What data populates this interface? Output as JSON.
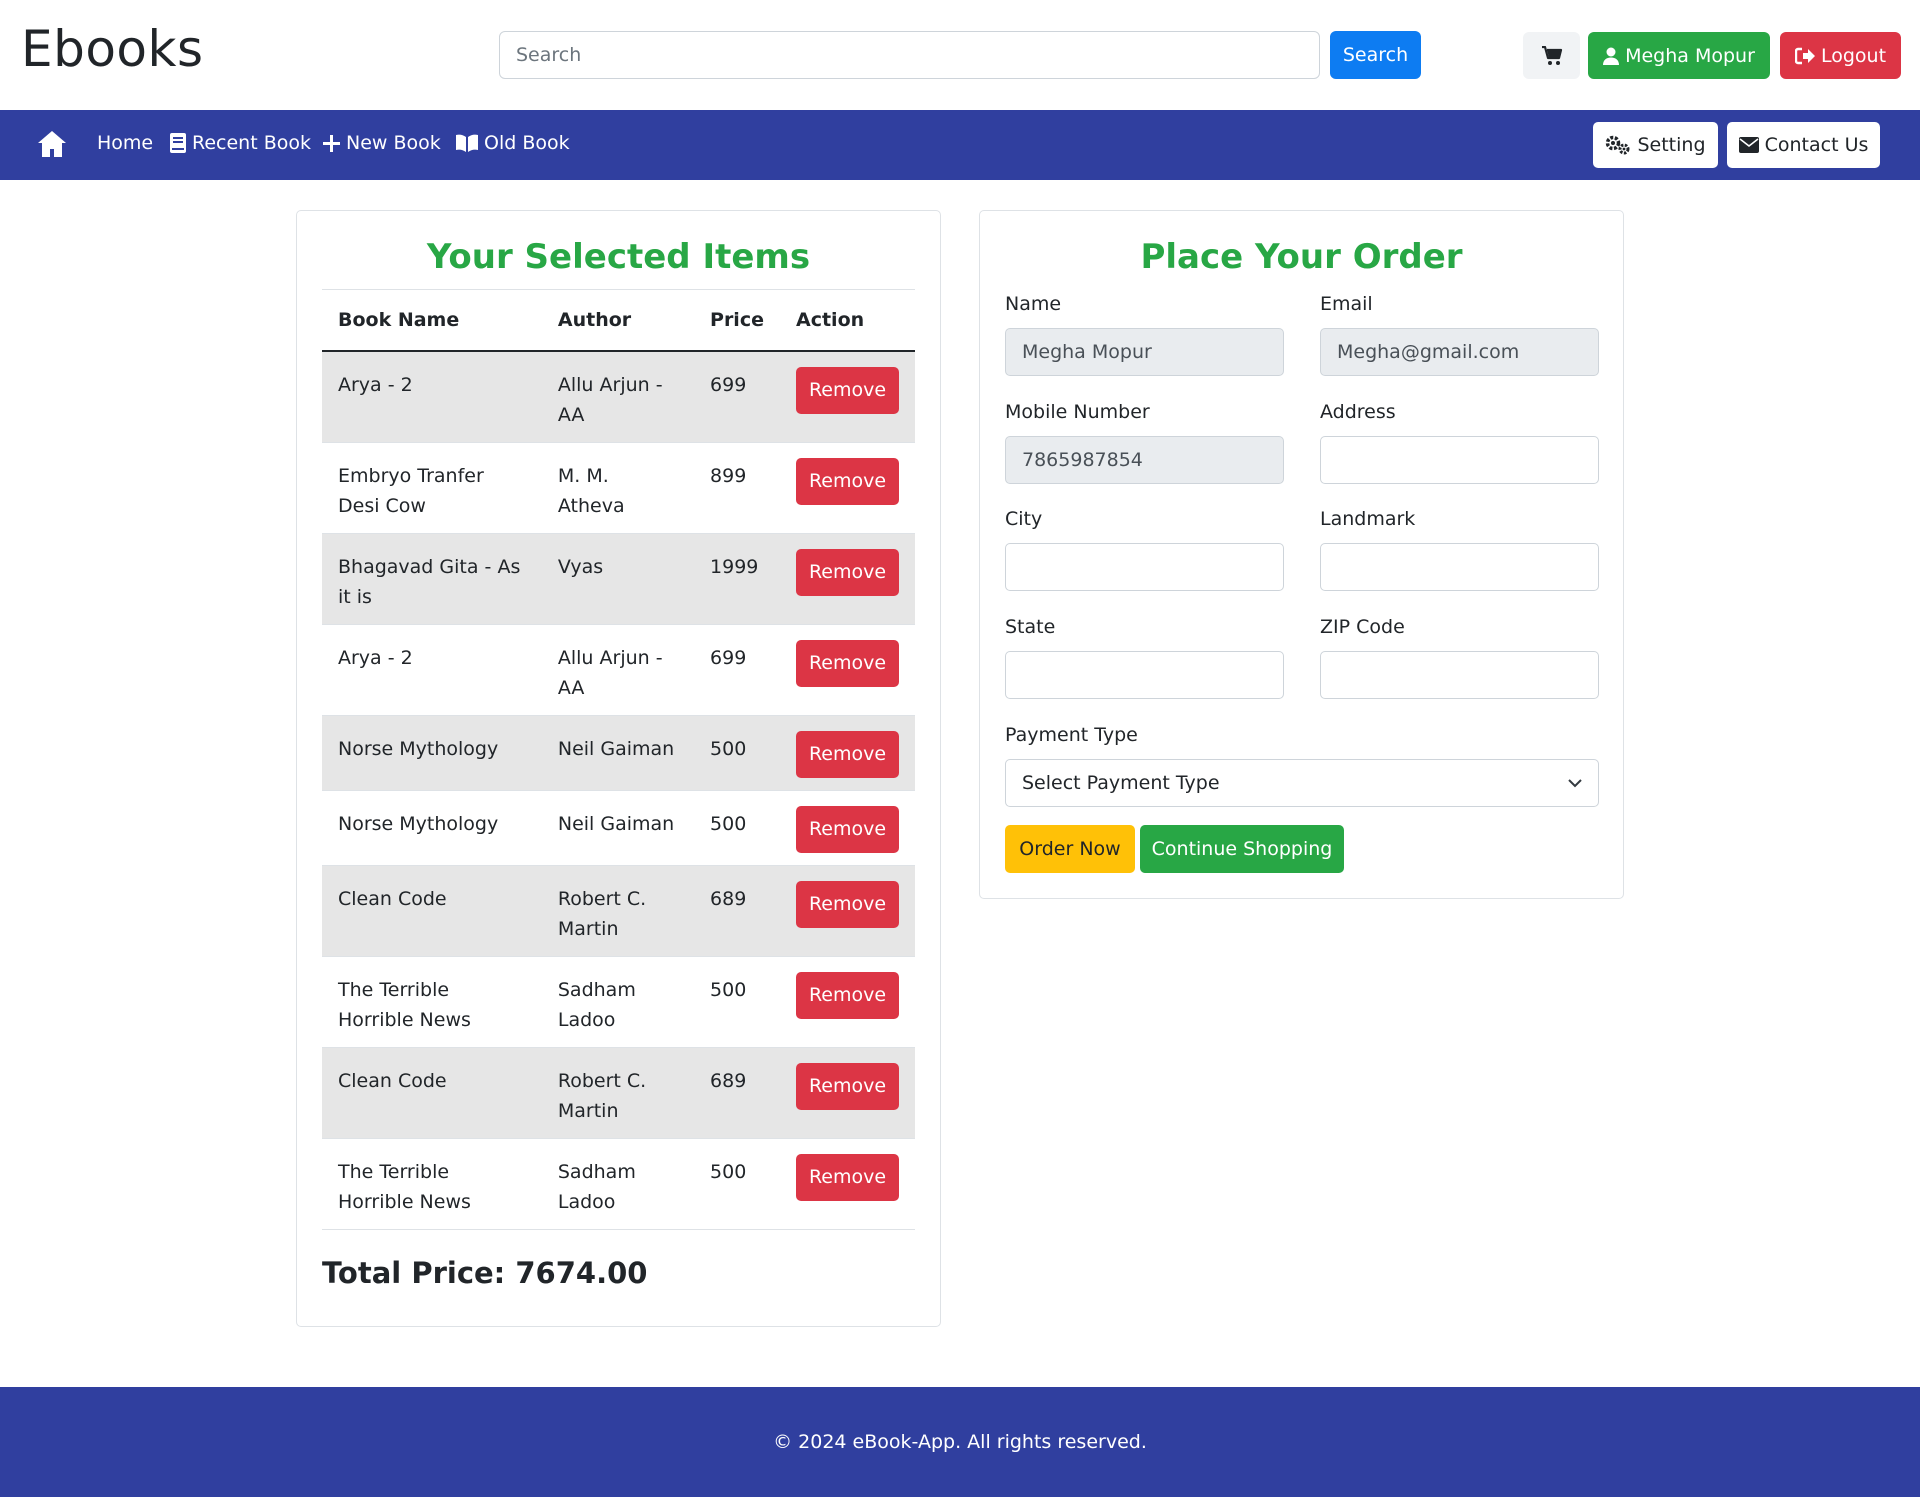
{
  "header": {
    "brand": "Ebooks",
    "search_placeholder": "Search",
    "search_value": "",
    "search_button": "Search",
    "user_name": "Megha Mopur",
    "logout_label": "Logout"
  },
  "navbar": {
    "items": [
      {
        "label": "Home",
        "icon": "home-icon"
      },
      {
        "label": "Recent Book",
        "icon": "book-icon"
      },
      {
        "label": "New Book",
        "icon": "plus-icon"
      },
      {
        "label": "Old Book",
        "icon": "open-book-icon"
      }
    ],
    "setting_label": "Setting",
    "contact_label": "Contact Us"
  },
  "cart": {
    "title": "Your Selected Items",
    "columns": [
      "Book Name",
      "Author",
      "Price",
      "Action"
    ],
    "rows": [
      {
        "book": "Arya - 2",
        "author": "Allu Arjun - AA",
        "price": "699",
        "action": "Remove"
      },
      {
        "book": "Embryo Tranfer Desi Cow",
        "author": "M. M. Atheva",
        "price": "899",
        "action": "Remove"
      },
      {
        "book": "Bhagavad Gita - As it is",
        "author": "Vyas",
        "price": "1999",
        "action": "Remove"
      },
      {
        "book": "Arya - 2",
        "author": "Allu Arjun - AA",
        "price": "699",
        "action": "Remove"
      },
      {
        "book": "Norse Mythology",
        "author": "Neil Gaiman",
        "price": "500",
        "action": "Remove"
      },
      {
        "book": "Norse Mythology",
        "author": "Neil Gaiman",
        "price": "500",
        "action": "Remove"
      },
      {
        "book": "Clean Code",
        "author": "Robert C. Martin",
        "price": "689",
        "action": "Remove"
      },
      {
        "book": "The Terrible Horrible News",
        "author": "Sadham Ladoo",
        "price": "500",
        "action": "Remove"
      },
      {
        "book": "Clean Code",
        "author": "Robert C. Martin",
        "price": "689",
        "action": "Remove"
      },
      {
        "book": "The Terrible Horrible News",
        "author": "Sadham Ladoo",
        "price": "500",
        "action": "Remove"
      }
    ],
    "total_label": "Total Price: 7674.00"
  },
  "order": {
    "title": "Place Your Order",
    "name_label": "Name",
    "name_value": "Megha Mopur",
    "email_label": "Email",
    "email_value": "Megha@gmail.com",
    "mobile_label": "Mobile Number",
    "mobile_value": "7865987854",
    "address_label": "Address",
    "address_value": "",
    "city_label": "City",
    "city_value": "",
    "landmark_label": "Landmark",
    "landmark_value": "",
    "state_label": "State",
    "state_value": "",
    "zip_label": "ZIP Code",
    "zip_value": "",
    "payment_label": "Payment Type",
    "payment_selected": "Select Payment Type",
    "order_button": "Order Now",
    "continue_button": "Continue Shopping"
  },
  "footer": {
    "text": "© 2024 eBook-App. All rights reserved."
  },
  "colors": {
    "navbar": "#303f9f",
    "title_green": "#28a745",
    "danger": "#dc3545",
    "primary": "#0d7cf2",
    "warning": "#ffc107"
  }
}
